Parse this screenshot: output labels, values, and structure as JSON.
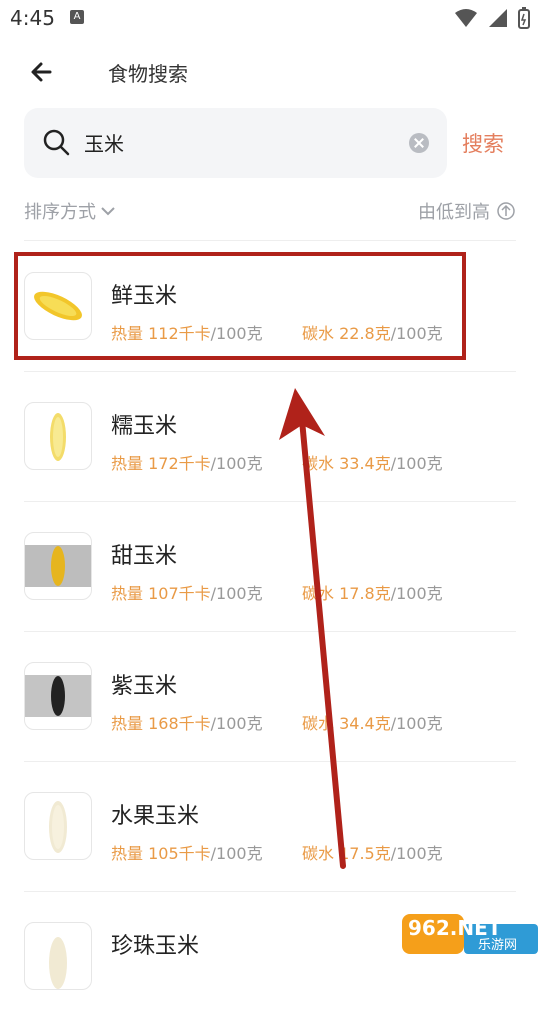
{
  "status_bar": {
    "time": "4:45",
    "a_label": "A"
  },
  "header": {
    "title": "食物搜索"
  },
  "search": {
    "query": "玉米",
    "button": "搜索"
  },
  "sort": {
    "left_label": "排序方式",
    "right_label": "由低到高"
  },
  "items": [
    {
      "name": "鲜玉米",
      "kcal": "热量 112千卡",
      "kcal_unit": "/100克",
      "carb": "碳水 22.8克",
      "carb_unit": "/100克"
    },
    {
      "name": "糯玉米",
      "kcal": "热量 172千卡",
      "kcal_unit": "/100克",
      "carb": "碳水 33.4克",
      "carb_unit": "/100克"
    },
    {
      "name": "甜玉米",
      "kcal": "热量 107千卡",
      "kcal_unit": "/100克",
      "carb": "碳水 17.8克",
      "carb_unit": "/100克"
    },
    {
      "name": "紫玉米",
      "kcal": "热量 168千卡",
      "kcal_unit": "/100克",
      "carb": "碳水 34.4克",
      "carb_unit": "/100克"
    },
    {
      "name": "水果玉米",
      "kcal": "热量 105千卡",
      "kcal_unit": "/100克",
      "carb": "碳水 17.5克",
      "carb_unit": "/100克"
    },
    {
      "name": "珍珠玉米"
    }
  ],
  "watermark": {
    "text": "962.NET",
    "sub": "乐游网"
  },
  "colors": {
    "accent": "#e47e5d",
    "highlight": "#b0221a",
    "orange_text": "#e99a46"
  }
}
